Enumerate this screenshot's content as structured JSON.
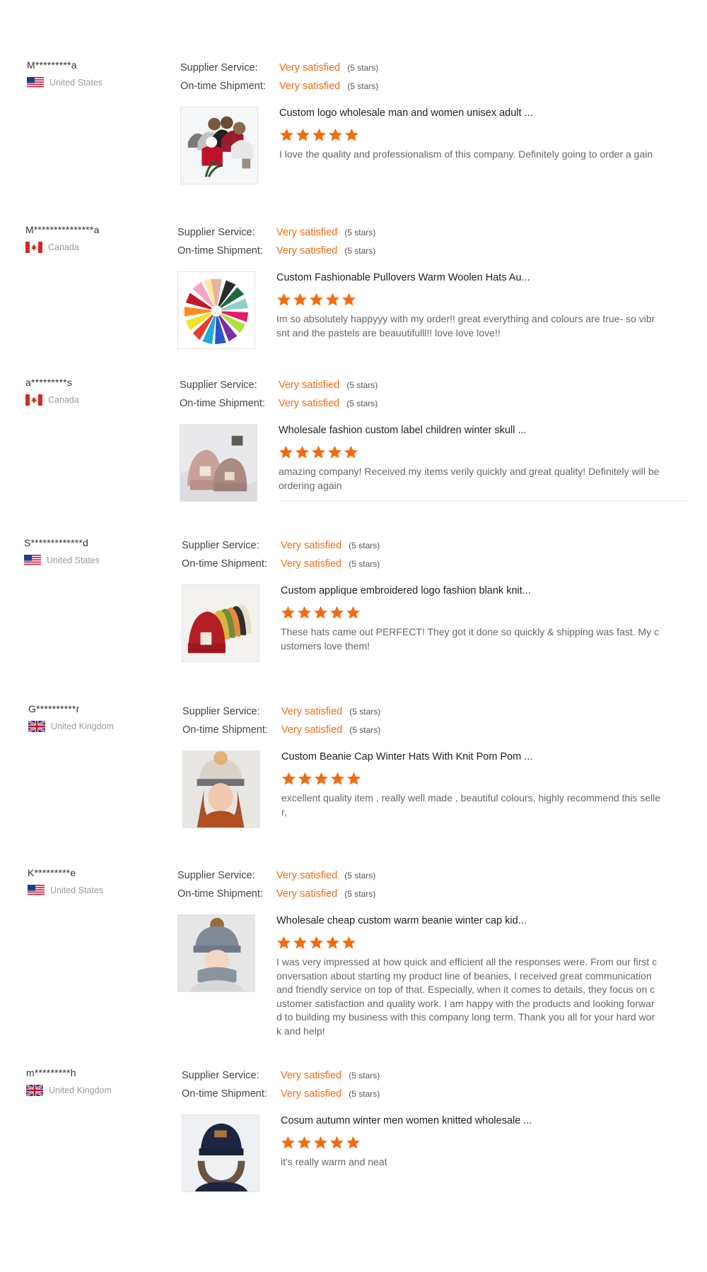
{
  "labels": {
    "supplier_service": "Supplier Service:",
    "ontime_shipment": "On-time Shipment:"
  },
  "colors": {
    "accent": "#f26b0f",
    "star": "#f26b0f"
  },
  "reviews": [
    {
      "buyer": "M*********a",
      "country": "United States",
      "flag": "us-flag-icon",
      "supplier_service": "Very satisfied",
      "supplier_stars": "(5 stars)",
      "shipment": "Very satisfied",
      "shipment_stars": "(5 stars)",
      "product_title": "Custom logo wholesale man and women unisex adult ...",
      "rating": 5,
      "comment": "I love the quality and professionalism of this company. Definitely going to order a gain"
    },
    {
      "buyer": "M***************a",
      "country": "Canada",
      "flag": "ca-flag-icon",
      "supplier_service": "Very satisfied",
      "supplier_stars": "(5 stars)",
      "shipment": "Very satisfied",
      "shipment_stars": "(5 stars)",
      "product_title": "Custom Fashionable Pullovers Warm Woolen Hats Au...",
      "rating": 5,
      "comment": "Im so absolutely happyyy with my order!! great everything and colours are true- so vibrsnt and the pastels are beauutifulll!! love love love!!"
    },
    {
      "buyer": "a*********s",
      "country": "Canada",
      "flag": "ca-flag-icon",
      "supplier_service": "Very satisfied",
      "supplier_stars": "(5 stars)",
      "shipment": "Very satisfied",
      "shipment_stars": "(5 stars)",
      "product_title": "Wholesale fashion custom label children winter skull ...",
      "rating": 5,
      "comment": "amazing company! Received my items verily quickly and great quality! Definitely will be ordering again"
    },
    {
      "buyer": "S*************d",
      "country": "United States",
      "flag": "us-flag-icon",
      "supplier_service": "Very satisfied",
      "supplier_stars": "(5 stars)",
      "shipment": "Very satisfied",
      "shipment_stars": "(5 stars)",
      "product_title": "Custom applique embroidered logo fashion blank knit...",
      "rating": 5,
      "comment": "These hats came out PERFECT! They got it done so quickly & shipping was fast. My customers love them!"
    },
    {
      "buyer": "G**********r",
      "country": "United Kingdom",
      "flag": "uk-flag-icon",
      "supplier_service": "Very satisfied",
      "supplier_stars": "(5 stars)",
      "shipment": "Very satisfied",
      "shipment_stars": "(5 stars)",
      "product_title": "Custom Beanie Cap Winter Hats With Knit Pom Pom ...",
      "rating": 5,
      "comment": "excellent quality item , really well made , beautiful colours,  highly recommend this seller,"
    },
    {
      "buyer": "K*********e",
      "country": "United States",
      "flag": "us-flag-icon",
      "supplier_service": "Very satisfied",
      "supplier_stars": "(5 stars)",
      "shipment": "Very satisfied",
      "shipment_stars": "(5 stars)",
      "product_title": "Wholesale cheap custom warm beanie winter cap kid...",
      "rating": 5,
      "comment": "I was very impressed at how quick and efficient all the responses were. From our first conversation about starting my product line of beanies, I received great communication and friendly service on top of that. Especially, when it comes to details, they focus on customer satisfaction and quality work. I am happy with the products and looking forward to building my business with this company long term. Thank you all for your hard work and help!"
    },
    {
      "buyer": "m*********h",
      "country": "United Kingdom",
      "flag": "uk-flag-icon",
      "supplier_service": "Very satisfied",
      "supplier_stars": "(5 stars)",
      "shipment": "Very satisfied",
      "shipment_stars": "(5 stars)",
      "product_title": "Cosum autumn winter men women knitted wholesale ...",
      "rating": 5,
      "comment": "it's really warm and neat"
    }
  ]
}
